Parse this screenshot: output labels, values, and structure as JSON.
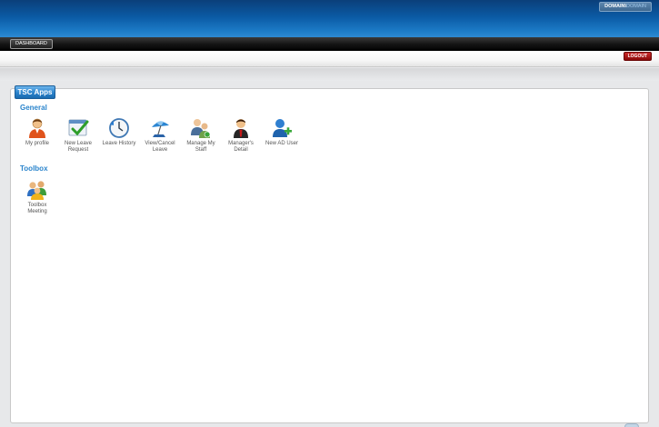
{
  "header": {
    "domain_label": "DOMAIN\\",
    "domain_value": "DOMAIN"
  },
  "nav": {
    "dashboard_label": "DASHBOARD"
  },
  "subbar": {
    "logout_label": "LOGOUT"
  },
  "panel": {
    "title": "TSC Apps"
  },
  "sections": {
    "general": {
      "title": "General",
      "apps": [
        {
          "line1": "My profile",
          "line2": "",
          "icon": "user-profile-icon"
        },
        {
          "line1": "New Leave",
          "line2": "Request",
          "icon": "leave-request-icon"
        },
        {
          "line1": "Leave History",
          "line2": "",
          "icon": "clock-history-icon"
        },
        {
          "line1": "View/Cancel",
          "line2": "Leave",
          "icon": "beach-umbrella-icon"
        },
        {
          "line1": "Manage My",
          "line2": "Staff",
          "icon": "staff-group-icon"
        },
        {
          "line1": "Manager's",
          "line2": "Detail",
          "icon": "manager-icon"
        },
        {
          "line1": "New AD User",
          "line2": "",
          "icon": "add-user-icon"
        }
      ]
    },
    "toolbox": {
      "title": "Toolbox",
      "apps": [
        {
          "line1": "Toolbox",
          "line2": "Meeting",
          "icon": "meeting-group-icon"
        }
      ]
    }
  },
  "colors": {
    "header_blue": "#0b5aa4",
    "section_title": "#2a84cc",
    "logout_red": "#a81414"
  }
}
